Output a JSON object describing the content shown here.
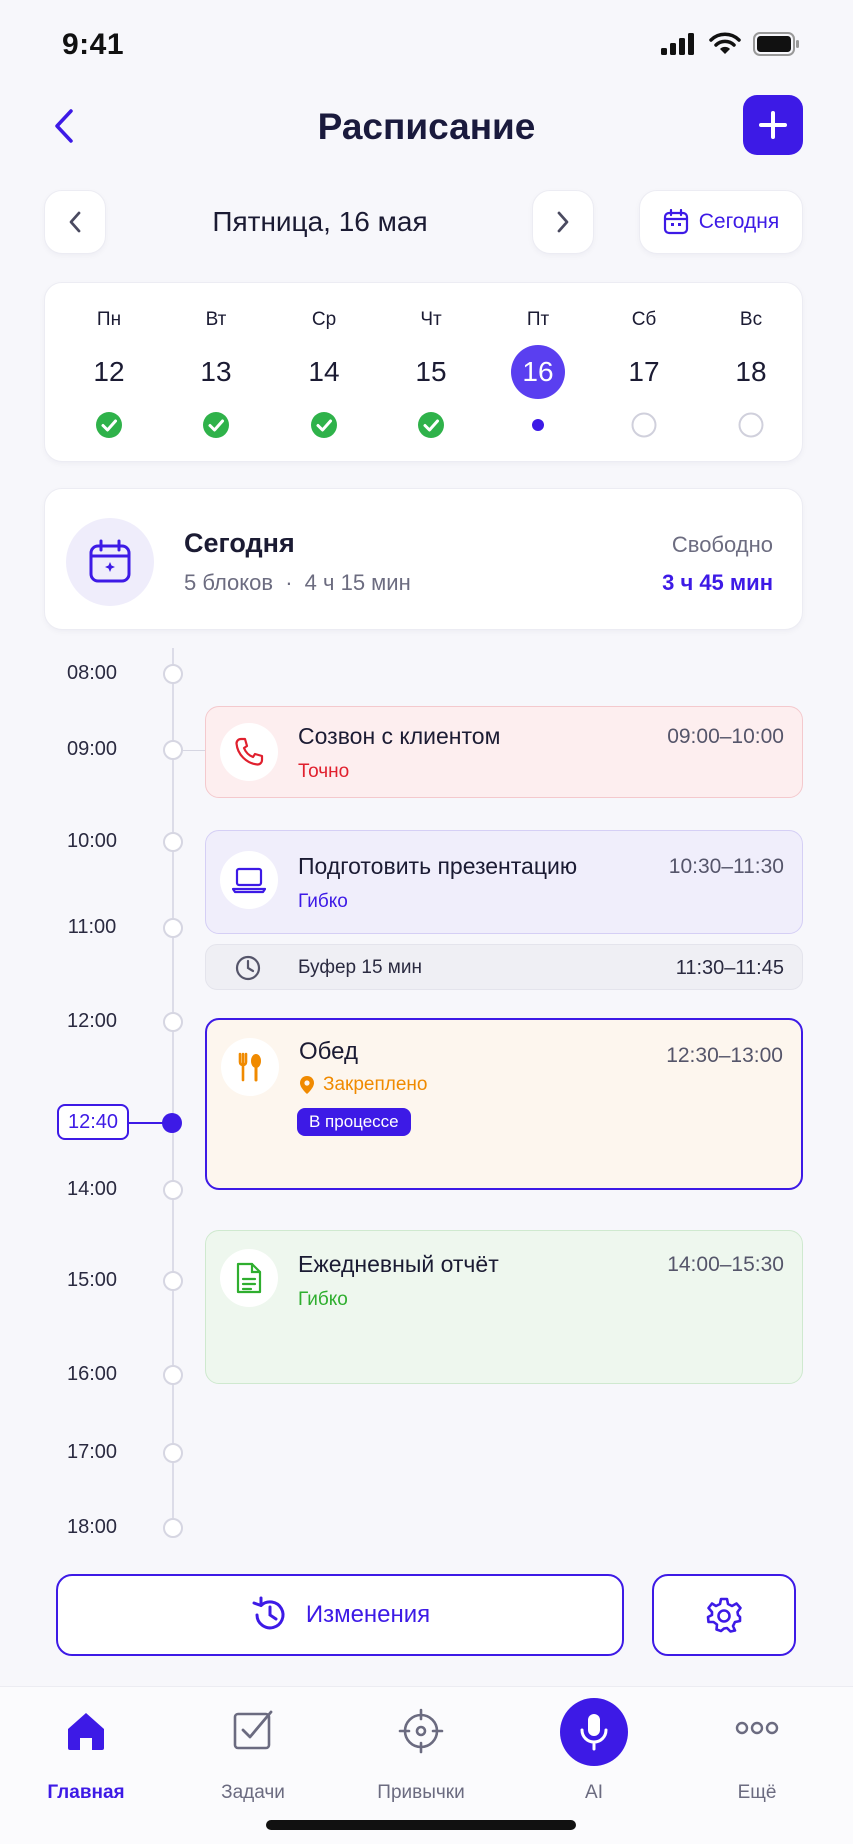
{
  "status_bar": {
    "time": "9:41"
  },
  "header": {
    "title": "Расписание"
  },
  "date_nav": {
    "label": "Пятница, 16 мая",
    "today_label": "Сегодня"
  },
  "week": [
    {
      "name": "Пн",
      "num": "12",
      "state": "done"
    },
    {
      "name": "Вт",
      "num": "13",
      "state": "done"
    },
    {
      "name": "Ср",
      "num": "14",
      "state": "done"
    },
    {
      "name": "Чт",
      "num": "15",
      "state": "done"
    },
    {
      "name": "Пт",
      "num": "16",
      "state": "current"
    },
    {
      "name": "Сб",
      "num": "17",
      "state": "empty"
    },
    {
      "name": "Вс",
      "num": "18",
      "state": "empty"
    }
  ],
  "summary": {
    "title": "Сегодня",
    "blocks": "5 блоков",
    "separator": "·",
    "duration": "4 ч 15 мин",
    "free_label": "Свободно",
    "free_value": "3 ч 45 мин"
  },
  "timeline": {
    "times": [
      "08:00",
      "09:00",
      "10:00",
      "11:00",
      "12:00",
      "14:00",
      "15:00",
      "16:00",
      "17:00",
      "18:00"
    ],
    "now": "12:40"
  },
  "events": {
    "call": {
      "title": "Созвон с клиентом",
      "time": "09:00–10:00",
      "tag": "Точно",
      "icon": "phone-icon"
    },
    "presentation": {
      "title": "Подготовить презентацию",
      "time": "10:30–11:30",
      "tag": "Гибко",
      "icon": "laptop-icon"
    },
    "buffer": {
      "title": "Буфер 15 мин",
      "time": "11:30–11:45",
      "icon": "clock-icon"
    },
    "lunch": {
      "title": "Обед",
      "time": "12:30–13:00",
      "tag": "Закреплено",
      "status": "В процессе",
      "icon": "fork-spoon-icon"
    },
    "report": {
      "title": "Ежедневный отчёт",
      "time": "14:00–15:30",
      "tag": "Гибко",
      "icon": "document-icon"
    }
  },
  "actions": {
    "changes_label": "Изменения"
  },
  "tabs": {
    "home": "Главная",
    "tasks": "Задачи",
    "habits": "Привычки",
    "ai": "AI",
    "more": "Ещё"
  },
  "colors": {
    "accent": "#3d1ae6",
    "call": "#e0202e",
    "flexible": "#3d1ae6",
    "pinned": "#f08a00",
    "report": "#2fae2f",
    "done": "#2fb24a"
  }
}
